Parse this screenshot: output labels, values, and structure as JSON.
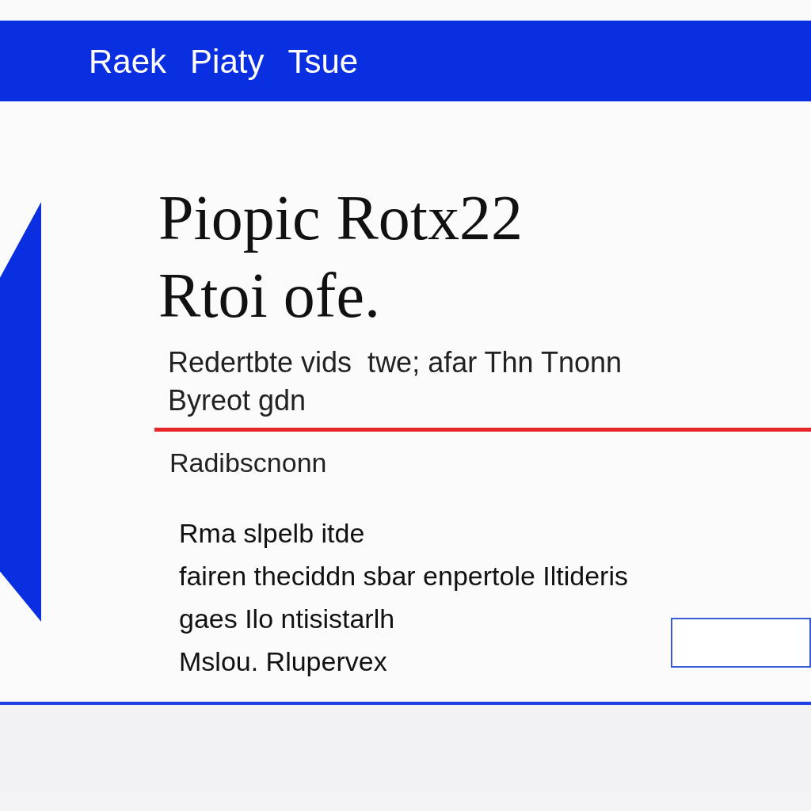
{
  "header": {
    "items": [
      "Raek",
      "Piaty",
      "Tsue"
    ]
  },
  "title_lines": [
    "Piopic Rotx22",
    "Rtoi ofe."
  ],
  "intro_lines": [
    "Redertbte vids  twe; afar Thn Tnonn",
    "Byreot gdn"
  ],
  "section_label": "Radibscnonn",
  "body_lines": [
    "Rma slpelb itde",
    "fairen theciddn sbar enpertole Iltideris",
    "gaes Ilo ntisistarlh",
    "Mslou. Rlupervex"
  ],
  "input": {
    "kind": "text"
  }
}
